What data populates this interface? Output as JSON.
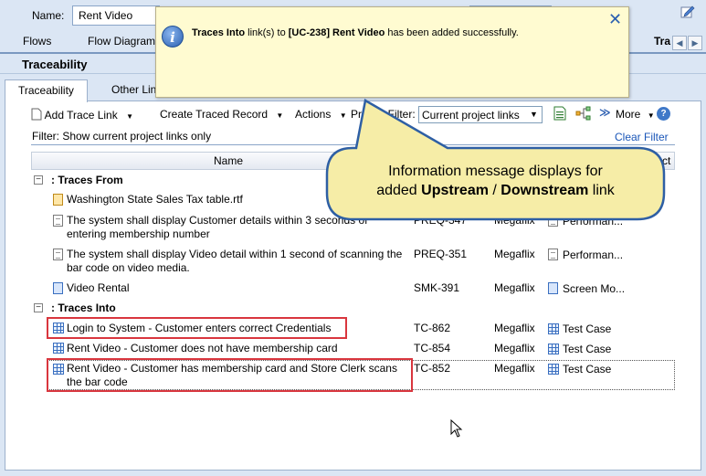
{
  "header": {
    "name_label": "Name:",
    "name_value": "Rent Video"
  },
  "top_tabs": {
    "flows": "Flows",
    "flow_diagram": "Flow Diagram",
    "traceability_partial": "Tra"
  },
  "section": {
    "title": "Traceability"
  },
  "sub_tabs": {
    "traceability": "Traceability",
    "other": "Other Lin"
  },
  "toolbar": {
    "add_trace_link": "Add Trace Link",
    "create_traced_record": "Create Traced Record",
    "actions": "Actions",
    "project_filter_label": "Project Filter:",
    "project_filter_value": "Current project links",
    "more": "More"
  },
  "filter": {
    "text": "Filter:  Show current project links only",
    "clear": "Clear Filter"
  },
  "grid": {
    "col_name": "Name",
    "col_project": "ct",
    "groups": {
      "from": ": Traces From",
      "into": ": Traces Into"
    },
    "rows": [
      {
        "name": "Washington State Sales Tax table.rtf",
        "id": "",
        "project": "",
        "type": ""
      },
      {
        "name": "The system shall display Customer details within 3 seconds of entering membership number",
        "id": "PREQ-347",
        "project": "Megaflix",
        "type": "Performan..."
      },
      {
        "name": "The system shall display Video detail within 1 second of scanning the bar code on video media.",
        "id": "PREQ-351",
        "project": "Megaflix",
        "type": "Performan..."
      },
      {
        "name": "Video Rental",
        "id": "SMK-391",
        "project": "Megaflix",
        "type": "Screen Mo..."
      },
      {
        "name": "Login to System - Customer enters correct Credentials",
        "id": "TC-862",
        "project": "Megaflix",
        "type": "Test Case"
      },
      {
        "name": "Rent Video - Customer does not have membership card",
        "id": "TC-854",
        "project": "Megaflix",
        "type": "Test Case"
      },
      {
        "name": "Rent Video - Customer has membership card and Store Clerk scans the bar code",
        "id": "TC-852",
        "project": "Megaflix",
        "type": "Test Case"
      }
    ]
  },
  "popup": {
    "bold1": "Traces Into",
    "text1": " link(s) to ",
    "bold2": "[UC-238] Rent Video",
    "text2": " has been added successfully."
  },
  "callout": {
    "line1": "Information message displays for",
    "pre": "added ",
    "bold1": "Upstream",
    "sep": " / ",
    "bold2": "Downstream",
    "post": " link"
  },
  "colors": {
    "accent": "#2a5fb0",
    "highlight_border": "#d9363e",
    "popup_bg": "#fffbd1",
    "callout_fill": "#f6eda7"
  }
}
